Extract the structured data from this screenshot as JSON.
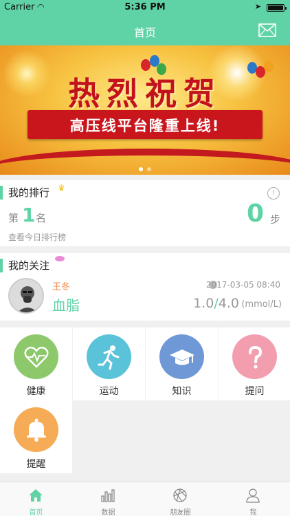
{
  "status_bar": {
    "carrier": "Carrier",
    "time": "5:36 PM"
  },
  "nav": {
    "title": "首页",
    "mail_icon": "mail-icon"
  },
  "banner": {
    "headline": "热烈祝贺",
    "subline": "高压线平台隆重上线!",
    "slide_count": 2,
    "active_slide": 1
  },
  "ranking": {
    "title": "我的排行",
    "prefix": "第",
    "rank": "1",
    "suffix": "名",
    "steps": "0",
    "steps_unit": "步",
    "link": "查看今日排行榜"
  },
  "follow": {
    "title": "我的关注",
    "name": "王冬",
    "metric": "血脂",
    "timestamp": "2017-03-05 08:40",
    "value_a": "1.0",
    "separator": "/",
    "value_b": "4.0",
    "unit": "(mmol/L)"
  },
  "features": [
    {
      "label": "健康",
      "icon": "heart-pulse-icon",
      "color": "#8dc96b"
    },
    {
      "label": "运动",
      "icon": "running-icon",
      "color": "#5ac3d9"
    },
    {
      "label": "知识",
      "icon": "graduation-cap-icon",
      "color": "#6f98d6"
    },
    {
      "label": "提问",
      "icon": "question-icon",
      "color": "#f29eaf"
    },
    {
      "label": "提醒",
      "icon": "bell-icon",
      "color": "#f6ac56"
    }
  ],
  "tabs": [
    {
      "label": "首页",
      "icon": "home-icon",
      "active": true
    },
    {
      "label": "数据",
      "icon": "bar-chart-icon",
      "active": false
    },
    {
      "label": "朋友圈",
      "icon": "aperture-icon",
      "active": false
    },
    {
      "label": "我",
      "icon": "person-icon",
      "active": false
    }
  ],
  "colors": {
    "brand": "#5fd3a6",
    "banner_red": "#c9161c"
  }
}
